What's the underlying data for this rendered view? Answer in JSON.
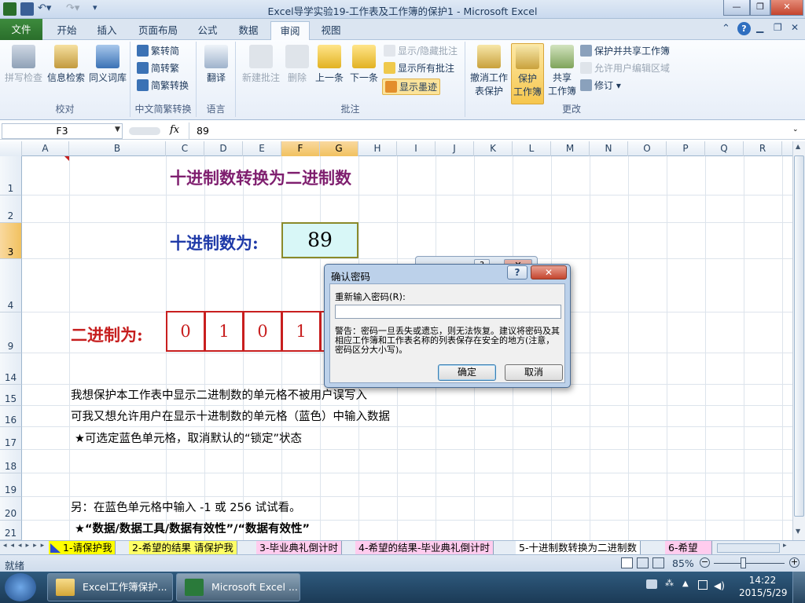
{
  "window": {
    "title": "Excel导学实验19-工作表及工作簿的保护1  -  Microsoft Excel"
  },
  "tabs": [
    "文件",
    "开始",
    "插入",
    "页面布局",
    "公式",
    "数据",
    "审阅",
    "视图"
  ],
  "ribbon": {
    "proofing": {
      "spell": "拼写检查",
      "research": "信息检索",
      "thesaurus": "同义词库",
      "group": "校对"
    },
    "chinese": {
      "t2s": "繁转简",
      "s2t": "简转繁",
      "convert": "简繁转换",
      "group": "中文简繁转换"
    },
    "language": {
      "translate": "翻译",
      "group": "语言"
    },
    "comments": {
      "new": "新建批注",
      "delete": "删除",
      "prev": "上一条",
      "next": "下一条",
      "showhide": "显示/隐藏批注",
      "showall": "显示所有批注",
      "ink": "显示墨迹",
      "group": "批注"
    },
    "changes": {
      "unprotect_l1": "撤消工作",
      "unprotect_l2": "表保护",
      "protect_l1": "保护",
      "protect_l2": "工作簿",
      "share_l1": "共享",
      "share_l2": "工作簿",
      "protect_share": "保护并共享工作簿",
      "allow_edit": "允许用户编辑区域",
      "track": "修订",
      "group": "更改"
    }
  },
  "formula_bar": {
    "name_box": "F3",
    "fx": "fx",
    "value": "89"
  },
  "columns": [
    "A",
    "B",
    "C",
    "D",
    "E",
    "F",
    "G",
    "H",
    "I",
    "J",
    "K",
    "L",
    "M",
    "N",
    "O",
    "P",
    "Q",
    "R"
  ],
  "rows": [
    "1",
    "2",
    "3",
    "4",
    "9",
    "14",
    "15",
    "16",
    "17",
    "18",
    "19",
    "20",
    "21"
  ],
  "sheet": {
    "title": "十进制数转换为二进制数",
    "decimal_label": "十进制数为:",
    "decimal_value": "89",
    "binary_label": "二进制为:",
    "bits": [
      "0",
      "1",
      "0",
      "1"
    ],
    "line15": "我想保护本工作表中显示二进制数的单元格不被用户误写入",
    "line16": "可我又想允许用户在显示十进制数的单元格（蓝色）中输入数据",
    "line17": "★可选定蓝色单元格，取消默认的“锁定”状态",
    "line20": "另：在蓝色单元格中输入 -1 或 256 试试看。",
    "line21": "★“数据/数据工具/数据有效性”/“数据有效性”"
  },
  "sheet_tabs": [
    "1-请保护我",
    "2-希望的结果 请保护我",
    "3-毕业典礼倒计时",
    "4-希望的结果-毕业典礼倒计时",
    "5-十进制数转换为二进制数",
    "6-希望"
  ],
  "status": {
    "ready": "就绪",
    "zoom": "85%"
  },
  "dialog": {
    "title": "确认密码",
    "prompt": "重新输入密码(R):",
    "warning": "警告：密码一旦丢失或遗忘，则无法恢复。建议将密码及其相应工作簿和工作表名称的列表保存在安全的地方(注意，密码区分大小写)。",
    "ok": "确定",
    "cancel": "取消",
    "help": "?",
    "close": "✕"
  },
  "taskbar": {
    "item1": "Excel工作簿保护...",
    "item2": "Microsoft Excel ...",
    "time": "14:22",
    "date": "2015/5/29"
  }
}
